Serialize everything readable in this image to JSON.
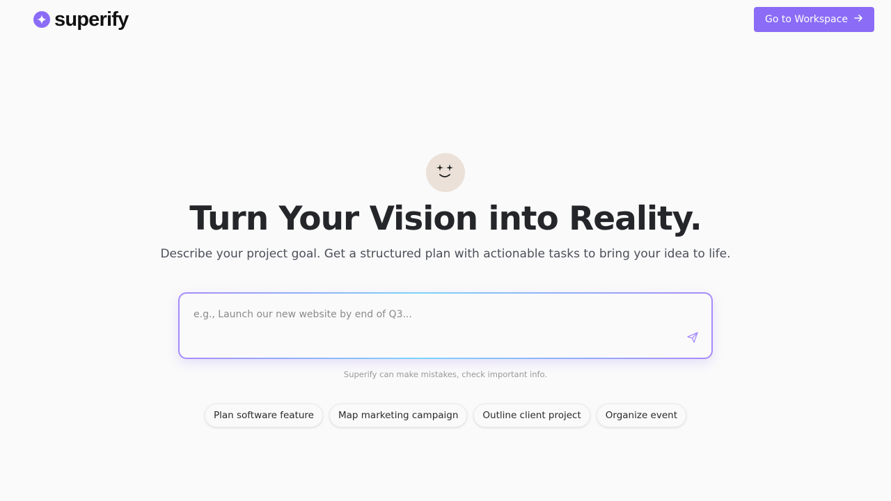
{
  "header": {
    "logo_text": "superify",
    "logo_icon": "sparkle-icon",
    "workspace_button_label": "Go to Workspace",
    "workspace_button_icon": "arrow-right-icon"
  },
  "hero": {
    "mascot_icon": "smiling-face-sparkles-icon",
    "title": "Turn Your Vision into Reality.",
    "subtitle": "Describe your project goal. Get a structured plan with actionable tasks to bring your idea to life."
  },
  "prompt": {
    "placeholder": "e.g., Launch our new website by end of Q3...",
    "value": "",
    "send_icon": "send-icon"
  },
  "disclaimer": "Superify can make mistakes, check important info.",
  "suggestions": [
    "Plan software feature",
    "Map marketing campaign",
    "Outline client project",
    "Organize event"
  ],
  "colors": {
    "accent": "#8b6cf6",
    "background": "#fafafa",
    "title": "#25262a",
    "mascot_bg": "#ebe1d8"
  }
}
